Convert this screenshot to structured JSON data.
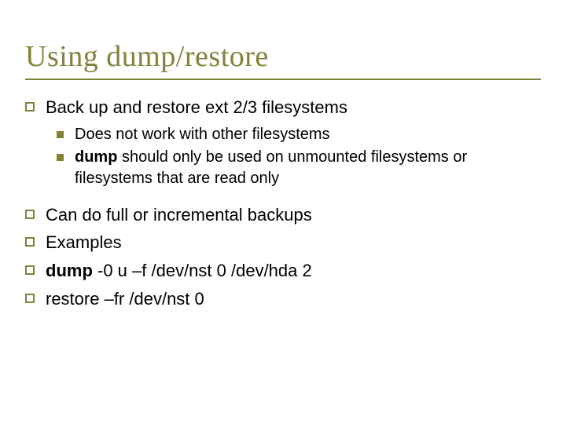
{
  "title": "Using dump/restore",
  "items": [
    {
      "text": "Back up and restore ext 2/3 filesystems",
      "sub": [
        {
          "pre": "",
          "bold": "",
          "post": "Does not work with other filesystems"
        },
        {
          "pre": "",
          "bold": "dump",
          "post": " should only be used on unmounted filesystems or filesystems that are read only"
        }
      ]
    },
    {
      "text": "Can do full or incremental backups"
    },
    {
      "text": "Examples"
    },
    {
      "bold": "dump",
      "text": " -0 u –f /dev/nst 0 /dev/hda 2"
    },
    {
      "text": "restore –fr /dev/nst 0"
    }
  ]
}
